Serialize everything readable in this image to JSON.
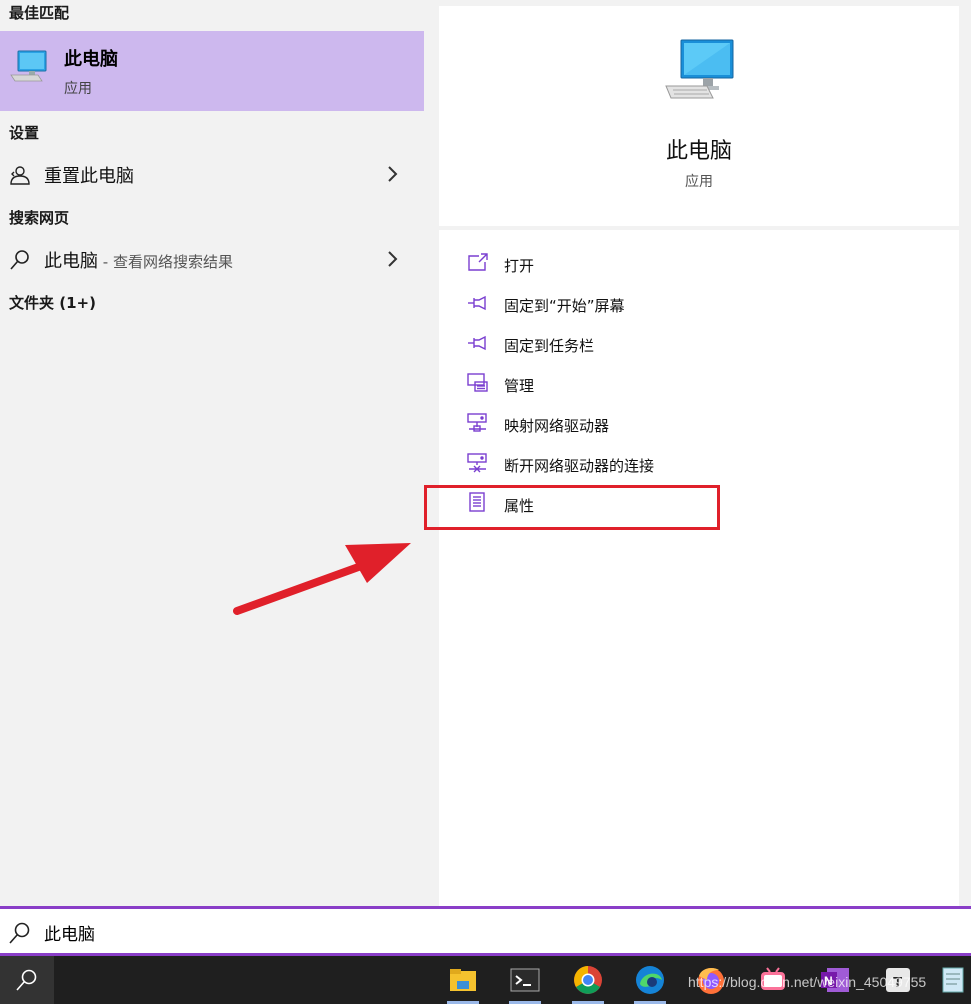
{
  "left": {
    "best_match_header": "最佳匹配",
    "best_match": {
      "title": "此电脑",
      "subtitle": "应用"
    },
    "settings_header": "设置",
    "settings_item": {
      "label": "重置此电脑"
    },
    "web_header": "搜索网页",
    "web_item": {
      "label": "此电脑",
      "suffix": " - 查看网络搜索结果"
    },
    "folders_header": "文件夹 (1+)"
  },
  "detail": {
    "title": "此电脑",
    "subtitle": "应用",
    "actions": [
      {
        "label": "打开",
        "icon": "open-icon"
      },
      {
        "label": "固定到“开始”屏幕",
        "icon": "pin-icon"
      },
      {
        "label": "固定到任务栏",
        "icon": "pin-icon"
      },
      {
        "label": "管理",
        "icon": "manage-icon"
      },
      {
        "label": "映射网络驱动器",
        "icon": "map-drive-icon"
      },
      {
        "label": "断开网络驱动器的连接",
        "icon": "disconnect-drive-icon"
      },
      {
        "label": "属性",
        "icon": "properties-icon"
      }
    ]
  },
  "search": {
    "value": "此电脑"
  },
  "taskbar": {
    "apps": [
      "file-explorer",
      "terminal",
      "chrome",
      "edge",
      "firefox",
      "bilibili",
      "onenote",
      "typora",
      "notepad"
    ],
    "watermark": "https://blog.csdn.net/weixin_45049755"
  },
  "colors": {
    "accent": "#8a3ec8",
    "selection": "#cdb8ee",
    "annotation": "#e0202a",
    "icon": "#7a3fd0"
  }
}
